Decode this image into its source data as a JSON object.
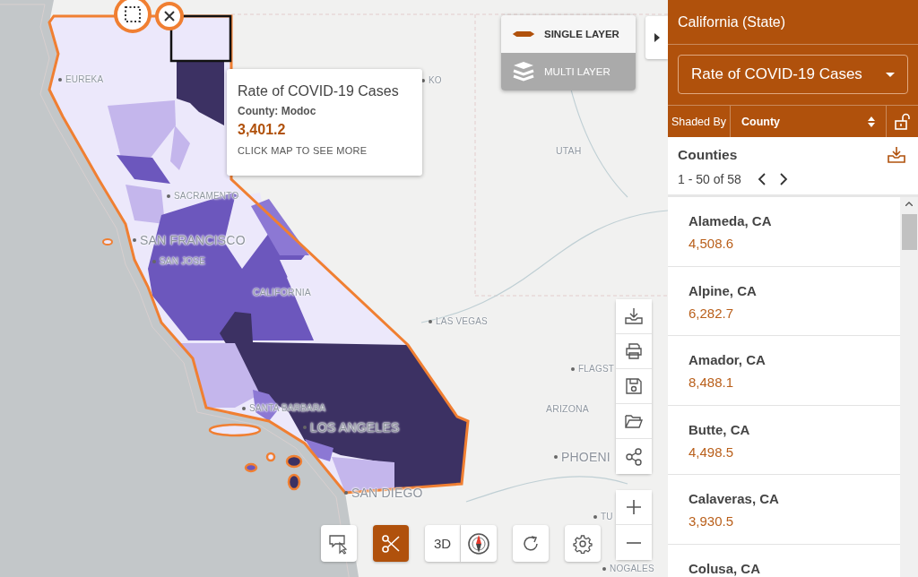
{
  "map": {
    "labels": [
      {
        "text": "EUREKA",
        "kind": "city"
      },
      {
        "text": "KO",
        "kind": "city"
      },
      {
        "text": "SACRAMENTO",
        "kind": "city"
      },
      {
        "text": "SAN FRANCISCO",
        "kind": "major"
      },
      {
        "text": "SAN JOSE",
        "kind": "city"
      },
      {
        "text": "CALIFORNIA",
        "kind": "state"
      },
      {
        "text": "UTAH",
        "kind": "state"
      },
      {
        "text": "LAS VEGAS",
        "kind": "city"
      },
      {
        "text": "FLAGST",
        "kind": "city"
      },
      {
        "text": "ARIZONA",
        "kind": "state"
      },
      {
        "text": "PHOENI",
        "kind": "major"
      },
      {
        "text": "SANTA BARBARA",
        "kind": "city"
      },
      {
        "text": "LOS ANGELES",
        "kind": "major"
      },
      {
        "text": "SAN DIEGO",
        "kind": "major"
      },
      {
        "text": "TU",
        "kind": "city"
      },
      {
        "text": "NOGALES",
        "kind": "city"
      }
    ],
    "layer_options": [
      {
        "label": "SINGLE LAYER",
        "kind": "single",
        "selected": true
      },
      {
        "label": "MULTI LAYER",
        "kind": "multi",
        "selected": false
      }
    ],
    "tooltip": {
      "title": "Rate of COVID-19 Cases",
      "subtitle": "County: Modoc",
      "value": "3,401.2",
      "hint": "CLICK MAP TO SEE MORE"
    },
    "bottom_tools": [
      {
        "kind": "select",
        "selected": false
      },
      {
        "kind": "scissors",
        "selected": true
      },
      {
        "kind": "threed",
        "label": "3D",
        "selected": false
      },
      {
        "kind": "compass",
        "selected": false
      },
      {
        "kind": "refresh",
        "selected": false
      },
      {
        "kind": "settings",
        "selected": false
      }
    ]
  },
  "sidebar": {
    "title": "California (State)",
    "measure": "Rate of COVID-19 Cases",
    "shaded_by_label": "Shaded By",
    "shaded_by_value": "County",
    "list_title": "Counties",
    "pagination": "1 - 50 of 58",
    "items": [
      {
        "name": "Alameda, CA",
        "value": "4,508.6"
      },
      {
        "name": "Alpine, CA",
        "value": "6,282.7"
      },
      {
        "name": "Amador, CA",
        "value": "8,488.1"
      },
      {
        "name": "Butte, CA",
        "value": "4,498.5"
      },
      {
        "name": "Calaveras, CA",
        "value": "3,930.5"
      },
      {
        "name": "Colusa, CA"
      }
    ]
  }
}
